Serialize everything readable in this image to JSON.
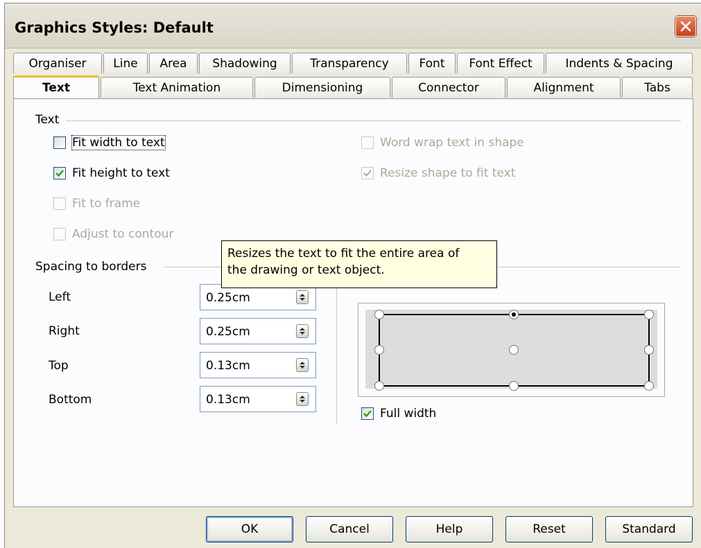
{
  "window": {
    "title": "Graphics Styles: Default"
  },
  "tabs": {
    "row1": [
      "Organiser",
      "Line",
      "Area",
      "Shadowing",
      "Transparency",
      "Font",
      "Font Effect",
      "Indents & Spacing"
    ],
    "row2": [
      "Text",
      "Text Animation",
      "Dimensioning",
      "Connector",
      "Alignment",
      "Tabs"
    ],
    "active": "Text"
  },
  "text_group": {
    "label": "Text",
    "fit_width": {
      "label": "Fit width to text",
      "checked": false
    },
    "fit_height": {
      "label": "Fit height to text",
      "checked": true
    },
    "fit_frame": {
      "label": "Fit to frame",
      "checked": false,
      "enabled": false
    },
    "adjust_contour": {
      "label": "Adjust to contour",
      "checked": false,
      "enabled": false
    },
    "word_wrap": {
      "label": "Word wrap text in shape",
      "checked": false,
      "enabled": false
    },
    "resize_shape": {
      "label": "Resize shape to fit text",
      "checked": true,
      "enabled": false
    }
  },
  "spacing_group": {
    "label": "Spacing to borders",
    "fields": [
      {
        "label": "Left",
        "value": "0.25cm"
      },
      {
        "label": "Right",
        "value": "0.25cm"
      },
      {
        "label": "Top",
        "value": "0.13cm"
      },
      {
        "label": "Bottom",
        "value": "0.13cm"
      }
    ]
  },
  "anchor": {
    "selected": "top-center",
    "full_width": {
      "label": "Full width",
      "checked": true
    }
  },
  "tooltip": {
    "line1": "Resizes the text to fit the entire area of",
    "line2": "the drawing or text object."
  },
  "buttons": {
    "ok": "OK",
    "cancel": "Cancel",
    "help": "Help",
    "reset": "Reset",
    "standard": "Standard"
  },
  "colors": {
    "accent_tab": "#f3b73c",
    "check": "#21a121",
    "tooltip_bg": "#ffffe1",
    "close": "#c6401c"
  }
}
